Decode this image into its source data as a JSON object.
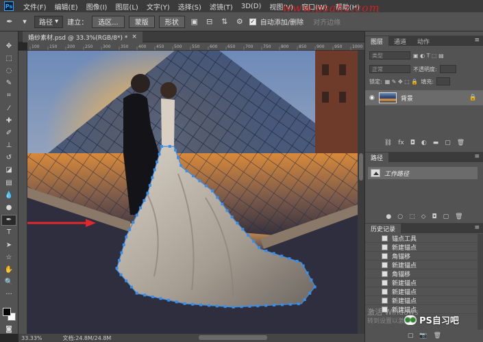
{
  "menubar": {
    "logo": "Ps",
    "items": [
      "文件(F)",
      "编辑(E)",
      "图像(I)",
      "图层(L)",
      "文字(Y)",
      "选择(S)",
      "滤镜(T)",
      "3D(D)",
      "视图(V)",
      "窗口(W)",
      "帮助(H)"
    ],
    "watermark": "www.psahz.com"
  },
  "options": {
    "mode": "路径",
    "make_label": "建立：",
    "selection_btn": "选区...",
    "mask_btn": "蒙版",
    "shape_btn": "形状",
    "auto_add_delete": "自动添加/删除",
    "align_edges": "对齐边缘"
  },
  "document": {
    "tab_title": "婚纱素材.psd @ 33.3%(RGB/8*) *",
    "ruler_ticks": [
      "100",
      "150",
      "200",
      "250",
      "300",
      "350",
      "400",
      "450",
      "500",
      "550",
      "600",
      "650",
      "700",
      "750",
      "800",
      "850",
      "900",
      "950",
      "1000"
    ]
  },
  "status": {
    "zoom": "33.33%",
    "doc_size": "文档:24.8M/24.8M"
  },
  "layers_panel": {
    "tabs": [
      "图层",
      "通道",
      "动作"
    ],
    "kind_label": "类型",
    "blend_mode": "正常",
    "opacity_label": "不透明度:",
    "lock_label": "锁定:",
    "fill_label": "填充:",
    "layer_name": "背景"
  },
  "paths_panel": {
    "tab": "路径",
    "path_name": "工作路径"
  },
  "history_panel": {
    "tab": "历史记录",
    "items": [
      "锚点工具",
      "新建锚点",
      "角锚移",
      "新建锚点",
      "角锚移",
      "新建锚点",
      "新建锚点",
      "新建锚点",
      "新建锚点"
    ]
  },
  "watermarks": {
    "windows_line1": "激活 Windows",
    "windows_line2": "转到设置以激活",
    "ps_brand": "PS自习吧"
  },
  "colors": {
    "accent_arrow": "#e0282e",
    "path_points": "#3a8ee6"
  }
}
